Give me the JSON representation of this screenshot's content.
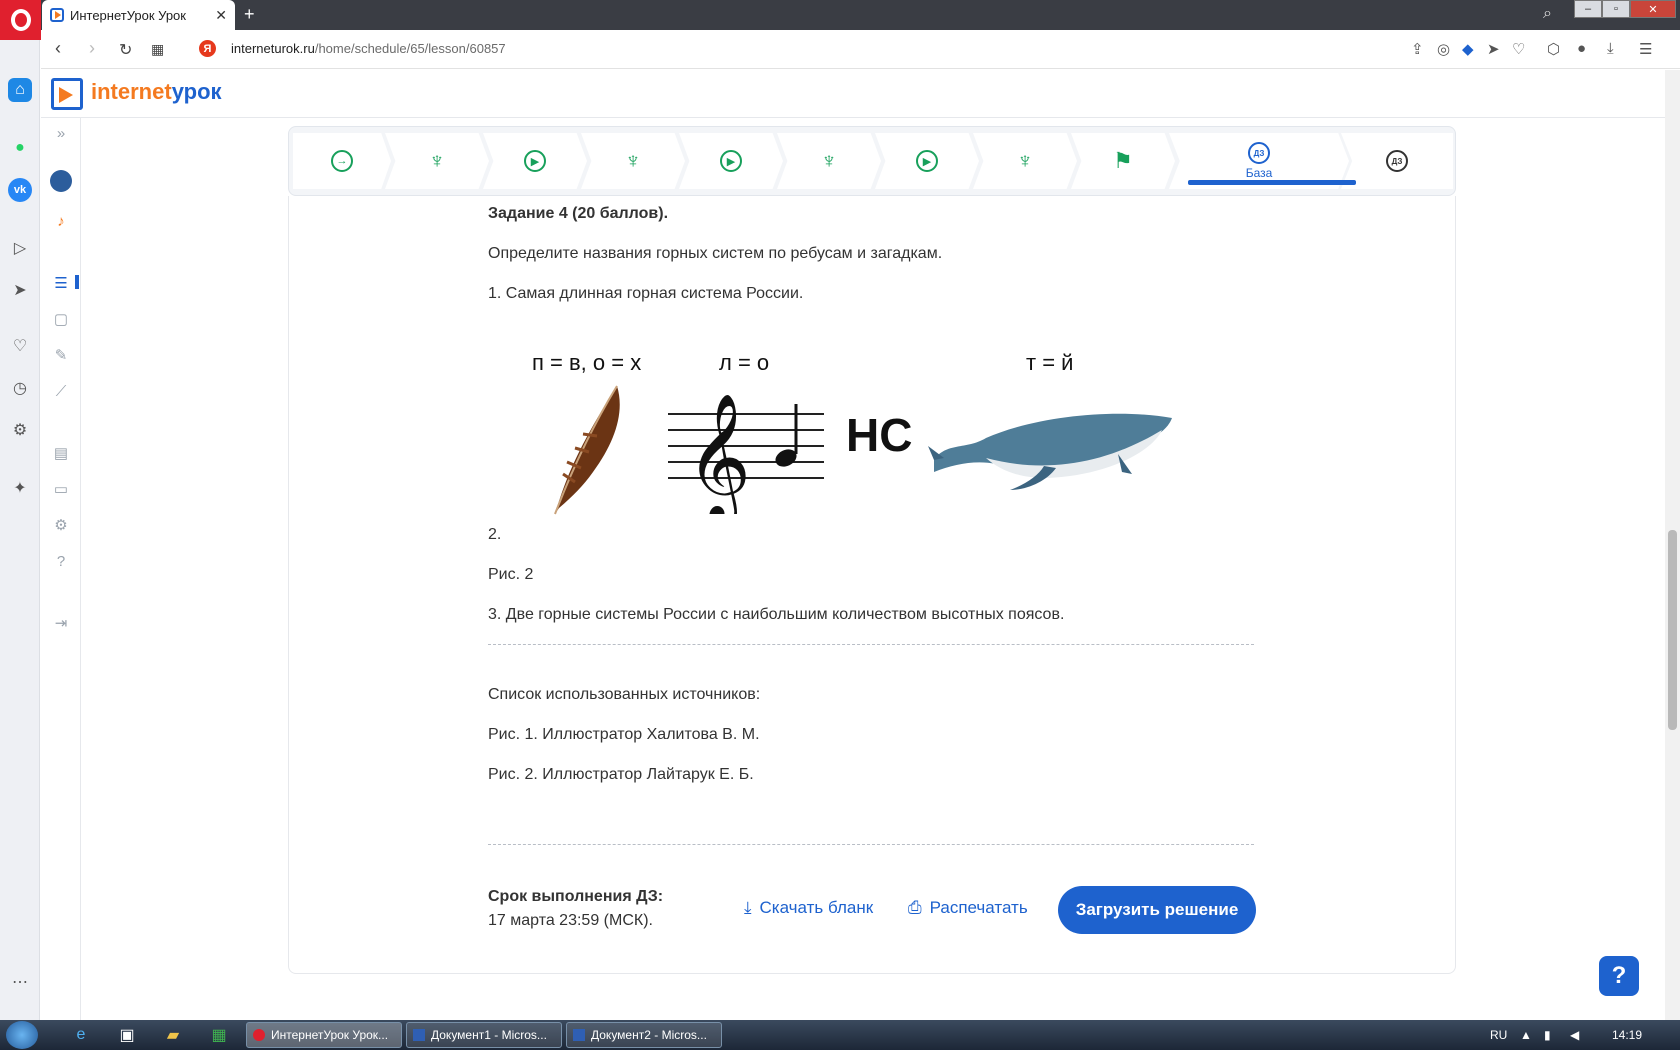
{
  "browser": {
    "tab_title": "ИнтернетУрок Урок",
    "tab_close": "✕",
    "new_tab": "+",
    "url_host": "interneturok.ru",
    "url_path": "/home/schedule/65/lesson/60857",
    "yandex_badge": "Я"
  },
  "site": {
    "logo_part1": "internet",
    "logo_part2": "урок"
  },
  "steps": {
    "active_label": "База",
    "active_badge": "ДЗ",
    "last_badge": "ДЗ"
  },
  "content": {
    "task_title": "Задание 4 (20 баллов).",
    "task_instruction": "Определите названия горных систем по ребусам и загадкам.",
    "item1": "1. Самая длинная горная система России.",
    "rebus_label1": "п = в, о = х",
    "rebus_label2": "л = о",
    "rebus_label3": "т = й",
    "rebus_letters": "НС",
    "item2": "2.",
    "fig2": "Рис. 2",
    "item3": "3. Две горные системы России с наибольшим количеством высотных поясов.",
    "sources_title": "Список использованных источников:",
    "source1": "Рис. 1. Иллюстратор Халитова В. М.",
    "source2": "Рис. 2. Иллюстратор Лайтарук Е. Б."
  },
  "footer": {
    "deadline_label": "Срок выполнения ДЗ:",
    "deadline_date": "17 марта 23:59 (МСК).",
    "download_label": "Скачать бланк",
    "print_label": "Распечатать",
    "upload_label": "Загрузить решение",
    "help_label": "?"
  },
  "taskbar": {
    "items": [
      "ИнтернетУрок Урок...",
      "Документ1 - Micros...",
      "Документ2 - Micros..."
    ],
    "lang": "RU",
    "time": "14:19"
  },
  "colors": {
    "accent": "#1e62ce",
    "brand_orange": "#f47a20",
    "step_green": "#18a05b"
  }
}
